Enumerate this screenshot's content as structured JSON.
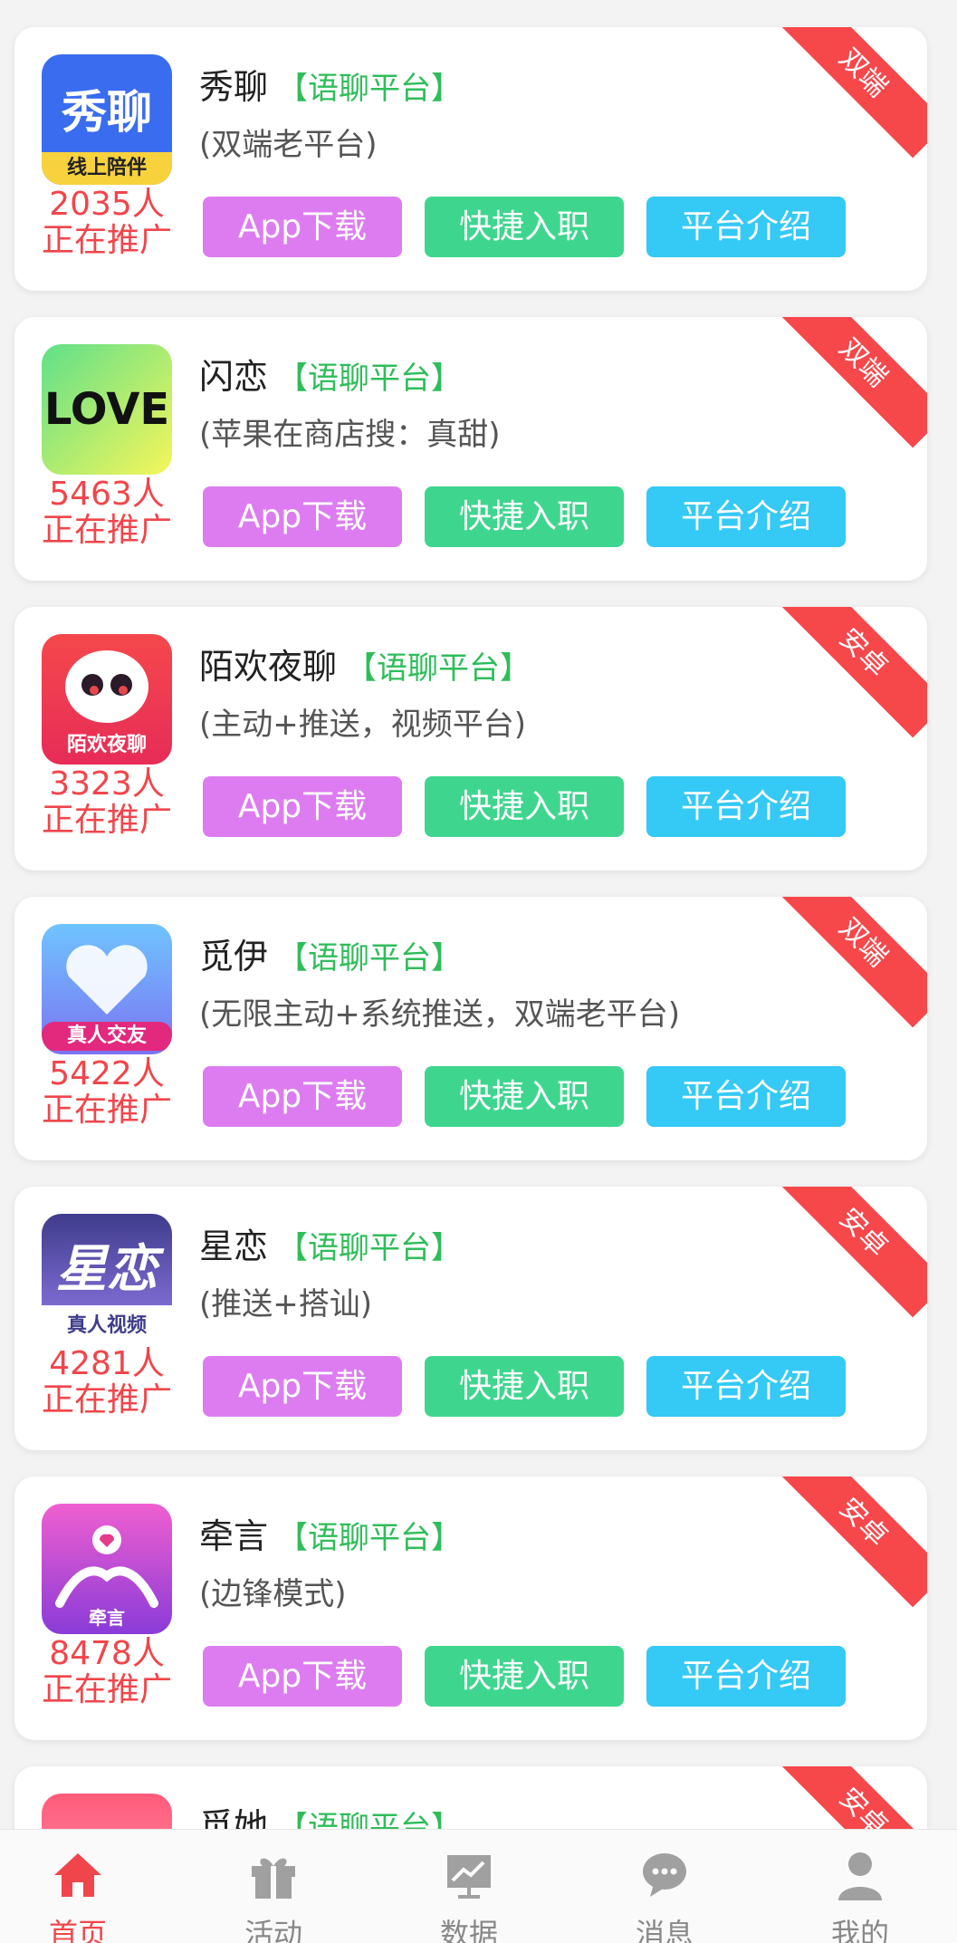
{
  "cards": [
    {
      "name": "秀聊",
      "category": "【语聊平台】",
      "desc": "(双端老平台)",
      "count": "2035人",
      "count_label": "正在推广",
      "ribbon": "双端",
      "icon_text": "秀聊",
      "icon_sub": "线上陪伴",
      "btn_download": "App下载",
      "btn_join": "快捷入职",
      "btn_intro": "平台介绍"
    },
    {
      "name": "闪恋",
      "category": "【语聊平台】",
      "desc": "(苹果在商店搜：真甜)",
      "count": "5463人",
      "count_label": "正在推广",
      "ribbon": "双端",
      "icon_text": "LOVE",
      "icon_sub": "",
      "btn_download": "App下载",
      "btn_join": "快捷入职",
      "btn_intro": "平台介绍"
    },
    {
      "name": "陌欢夜聊",
      "category": "【语聊平台】",
      "desc": "(主动+推送，视频平台)",
      "count": "3323人",
      "count_label": "正在推广",
      "ribbon": "安卓",
      "icon_text": "",
      "icon_sub": "陌欢夜聊",
      "btn_download": "App下载",
      "btn_join": "快捷入职",
      "btn_intro": "平台介绍"
    },
    {
      "name": "觅伊",
      "category": "【语聊平台】",
      "desc": "(无限主动+系统推送，双端老平台)",
      "count": "5422人",
      "count_label": "正在推广",
      "ribbon": "双端",
      "icon_text": "",
      "icon_sub": "真人交友",
      "btn_download": "App下载",
      "btn_join": "快捷入职",
      "btn_intro": "平台介绍"
    },
    {
      "name": "星恋",
      "category": "【语聊平台】",
      "desc": "(推送+搭讪)",
      "count": "4281人",
      "count_label": "正在推广",
      "ribbon": "安卓",
      "icon_text": "星恋",
      "icon_sub": "真人视频",
      "btn_download": "App下载",
      "btn_join": "快捷入职",
      "btn_intro": "平台介绍"
    },
    {
      "name": "牵言",
      "category": "【语聊平台】",
      "desc": "(边锋模式)",
      "count": "8478人",
      "count_label": "正在推广",
      "ribbon": "安卓",
      "icon_text": "",
      "icon_sub": "牵言",
      "btn_download": "App下载",
      "btn_join": "快捷入职",
      "btn_intro": "平台介绍"
    },
    {
      "name": "觅她",
      "category": "【语聊平台】",
      "desc": "",
      "count": "",
      "count_label": "",
      "ribbon": "安卓",
      "icon_text": "",
      "icon_sub": "",
      "btn_download": "",
      "btn_join": "",
      "btn_intro": ""
    }
  ],
  "tabs": [
    {
      "label": "首页",
      "icon": "home-icon",
      "active": true
    },
    {
      "label": "活动",
      "icon": "gift-icon",
      "active": false
    },
    {
      "label": "数据",
      "icon": "chart-icon",
      "active": false
    },
    {
      "label": "消息",
      "icon": "message-icon",
      "active": false
    },
    {
      "label": "我的",
      "icon": "user-icon",
      "active": false
    }
  ],
  "colors": {
    "accent": "#f0464b",
    "download": "#dd7cf0",
    "join": "#3ed68e",
    "intro": "#35c9f5",
    "category": "#2fbd5a"
  }
}
